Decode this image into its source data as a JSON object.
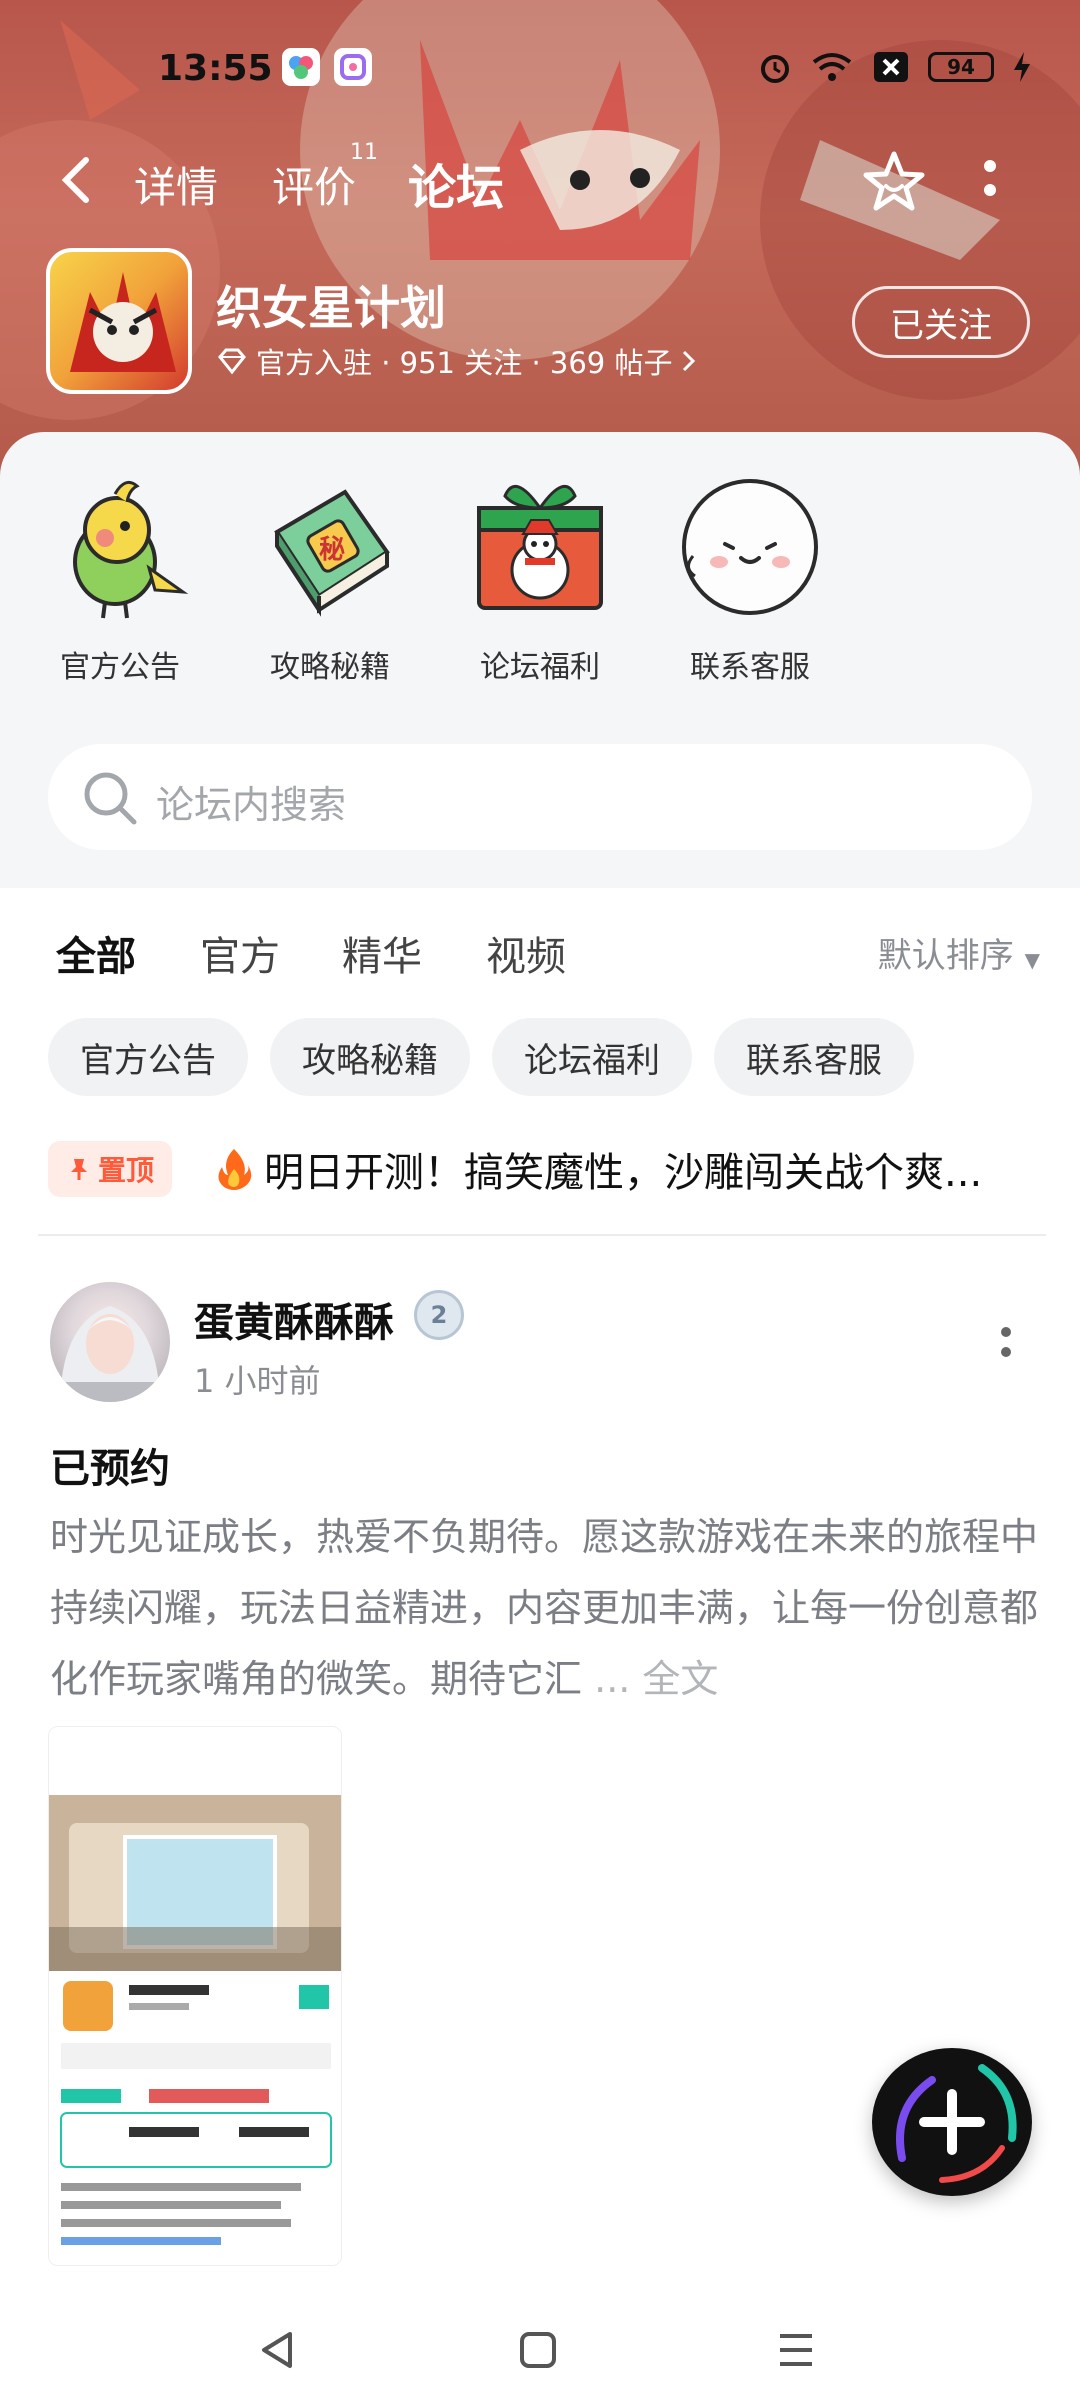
{
  "status_bar": {
    "time": "13:55",
    "battery": "94"
  },
  "nav": {
    "tabs": [
      {
        "label": "详情",
        "active": false
      },
      {
        "label": "评价",
        "active": false,
        "badge": "11"
      },
      {
        "label": "论坛",
        "active": true
      }
    ]
  },
  "game": {
    "title": "织女星计划",
    "meta": "官方入驻 · 951 关注 · 369 帖子",
    "follow_label": "已关注"
  },
  "shortcuts": [
    {
      "label": "官方公告",
      "icon": "parrot-icon"
    },
    {
      "label": "攻略秘籍",
      "icon": "secret-book-icon"
    },
    {
      "label": "论坛福利",
      "icon": "gift-box-icon"
    },
    {
      "label": "联系客服",
      "icon": "smiley-face-icon"
    }
  ],
  "search": {
    "placeholder": "论坛内搜索"
  },
  "filter_tabs": [
    {
      "label": "全部",
      "active": true
    },
    {
      "label": "官方",
      "active": false
    },
    {
      "label": "精华",
      "active": false
    },
    {
      "label": "视频",
      "active": false
    }
  ],
  "sort_label": "默认排序",
  "chips": [
    "官方公告",
    "攻略秘籍",
    "论坛福利",
    "联系客服"
  ],
  "pinned": {
    "tag": "置顶",
    "text": "明日开测！搞笑魔性，沙雕闯关战个爽..."
  },
  "post": {
    "author": "蛋黄酥酥酥",
    "level": "2",
    "time": "1 小时前",
    "title": "已预约",
    "body": "时光见证成长，热爱不负期待。愿这款游戏在未来的旅程中持续闪耀，玩法日益精进，内容更加丰满，让每一份创意都化作玩家嘴角的微笑。期待它汇",
    "more": "... 全文"
  },
  "colors": {
    "accent": "#21c6a8",
    "pin": "#ff5a3a"
  }
}
